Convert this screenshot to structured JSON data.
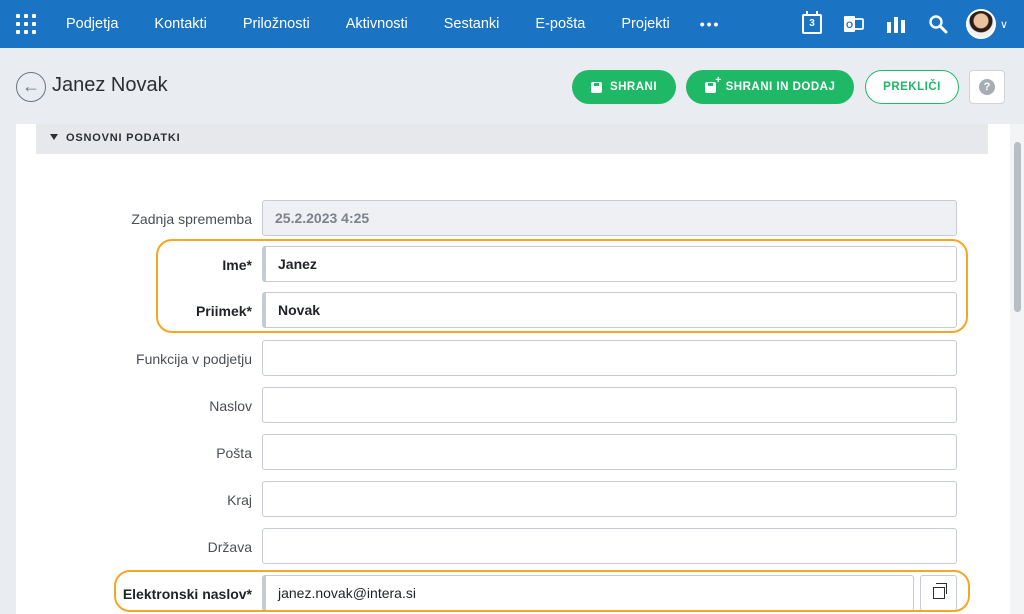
{
  "topnav": {
    "items": [
      "Podjetja",
      "Kontakti",
      "Priložnosti",
      "Aktivnosti",
      "Sestanki",
      "E-pošta",
      "Projekti"
    ],
    "more": "•••",
    "calendar_day": "3",
    "icons": [
      "apps-grid-icon",
      "calendar-icon",
      "outlook-icon",
      "reports-icon",
      "search-icon",
      "avatar",
      "chevron-down-icon"
    ]
  },
  "header": {
    "title": "Janez Novak",
    "save_label": "SHRANI",
    "save_add_label": "SHRANI IN DODAJ",
    "cancel_label": "PREKLIČI",
    "help_label": "?"
  },
  "section": {
    "title": "OSNOVNI PODATKI"
  },
  "form": {
    "last_change_label": "Zadnja sprememba",
    "last_change_value": "25.2.2023 4:25",
    "first_name_label": "Ime*",
    "first_name_value": "Janez",
    "last_name_label": "Priimek*",
    "last_name_value": "Novak",
    "job_label": "Funkcija v podjetju",
    "job_value": "",
    "address_label": "Naslov",
    "address_value": "",
    "post_label": "Pošta",
    "post_value": "",
    "city_label": "Kraj",
    "city_value": "",
    "country_label": "Država",
    "country_value": "",
    "email_label": "Elektronski naslov*",
    "email_value": "janez.novak@intera.si"
  },
  "colors": {
    "topbar": "#1b73c4",
    "accent_green": "#1fb866",
    "highlight": "#f5a623"
  }
}
